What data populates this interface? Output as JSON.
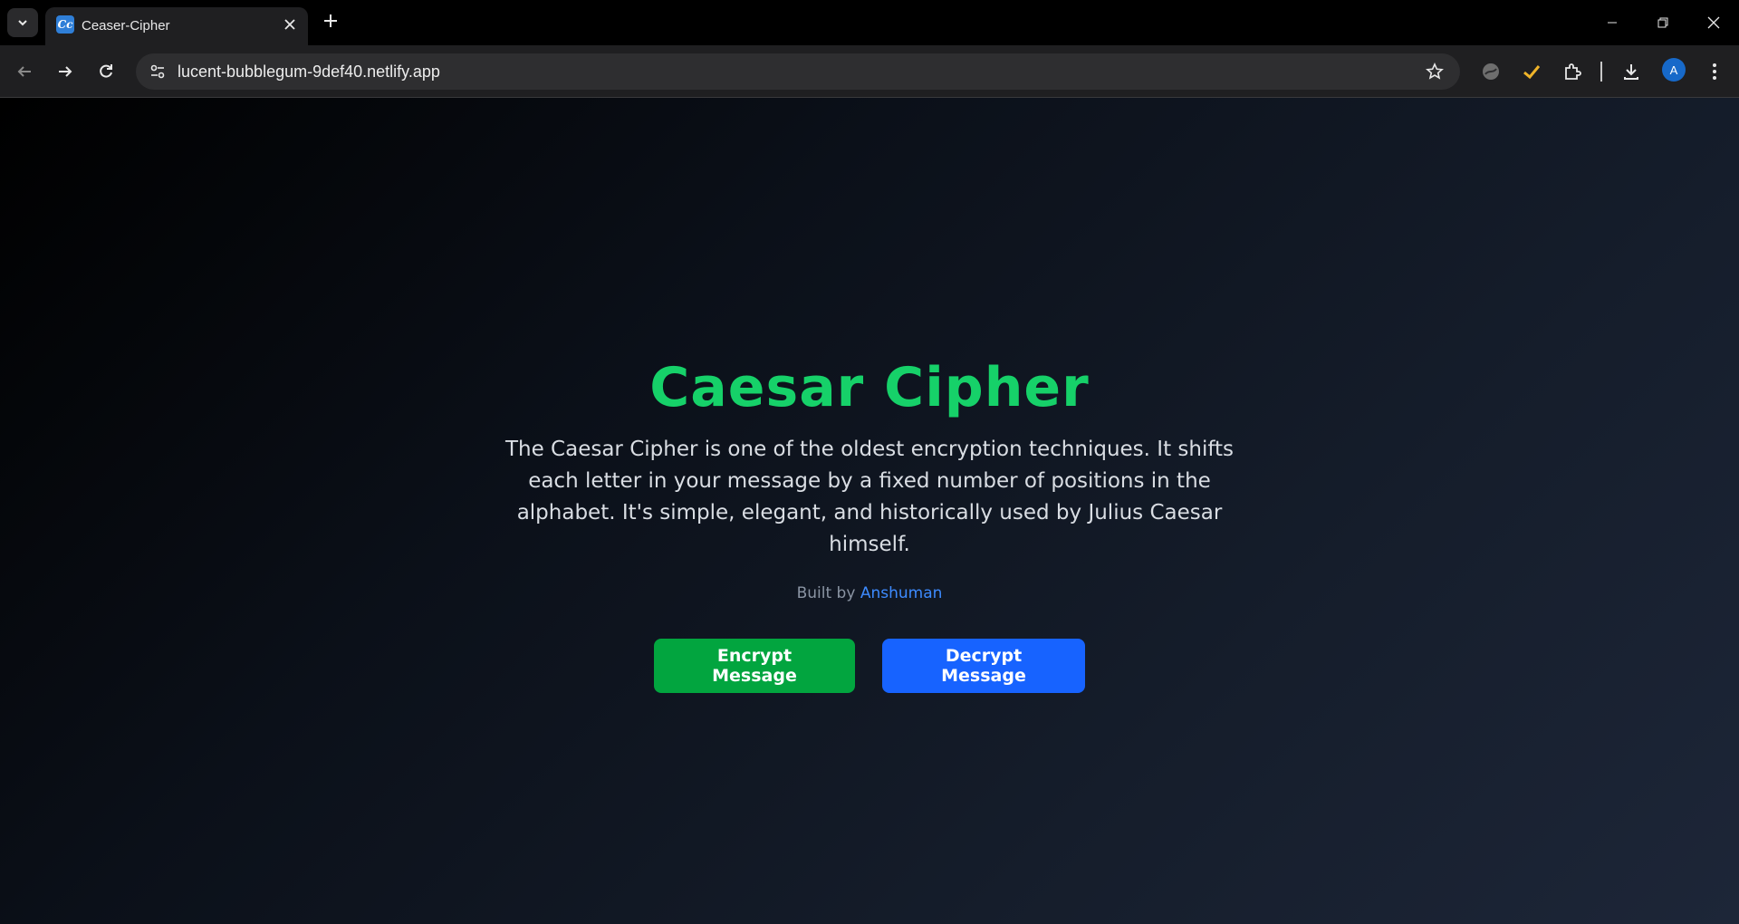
{
  "browser": {
    "tab_title": "Ceaser-Cipher",
    "favicon_text": "Cc",
    "url": "lucent-bubblegum-9def40.netlify.app",
    "profile_initial": "A",
    "icons": {
      "tab_menu": "chevron-down-icon",
      "close": "close-icon",
      "new_tab": "plus-icon",
      "back": "arrow-left-icon",
      "forward": "arrow-right-icon",
      "reload": "reload-icon",
      "site_info": "tune-icon",
      "bookmark": "star-icon",
      "extensions": "puzzle-icon",
      "download": "download-icon",
      "menu": "kebab-menu-icon"
    }
  },
  "hero": {
    "title": "Caesar Cipher",
    "description": "The Caesar Cipher is one of the oldest encryption techniques. It shifts each letter in your message by a fixed number of positions in the alphabet. It's simple, elegant, and historically used by Julius Caesar himself.",
    "credit_prefix": "Built by ",
    "credit_name": "Anshuman"
  },
  "actions": {
    "encrypt_label": "Encrypt Message",
    "decrypt_label": "Decrypt Message"
  },
  "colors": {
    "title": "#16d169",
    "encrypt": "#02a53f",
    "decrypt": "#1763ff",
    "link": "#3d8bff"
  }
}
